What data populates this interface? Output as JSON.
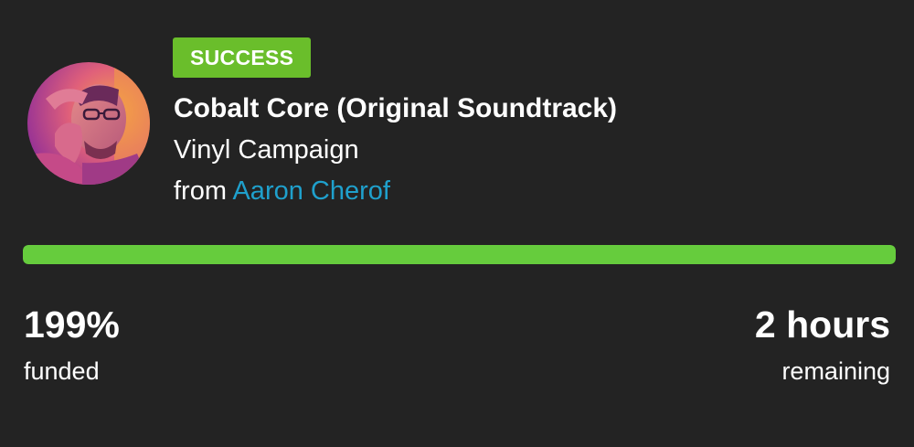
{
  "campaign": {
    "status_badge": "SUCCESS",
    "title": "Cobalt Core (Original Soundtrack)",
    "subtitle": "Vinyl Campaign",
    "byline_prefix": "from",
    "artist": "Aaron Cherof",
    "avatar_icon": "artist-avatar-photo"
  },
  "progress": {
    "percent_funded": 199,
    "bar_fill_fraction": 1.0,
    "bar_color": "#66cc3d"
  },
  "stats": {
    "funded_value": "199%",
    "funded_label": "funded",
    "time_value": "2 hours",
    "time_label": "remaining"
  },
  "colors": {
    "background": "#232323",
    "badge": "#6abe2b",
    "link": "#1fa0cc"
  }
}
